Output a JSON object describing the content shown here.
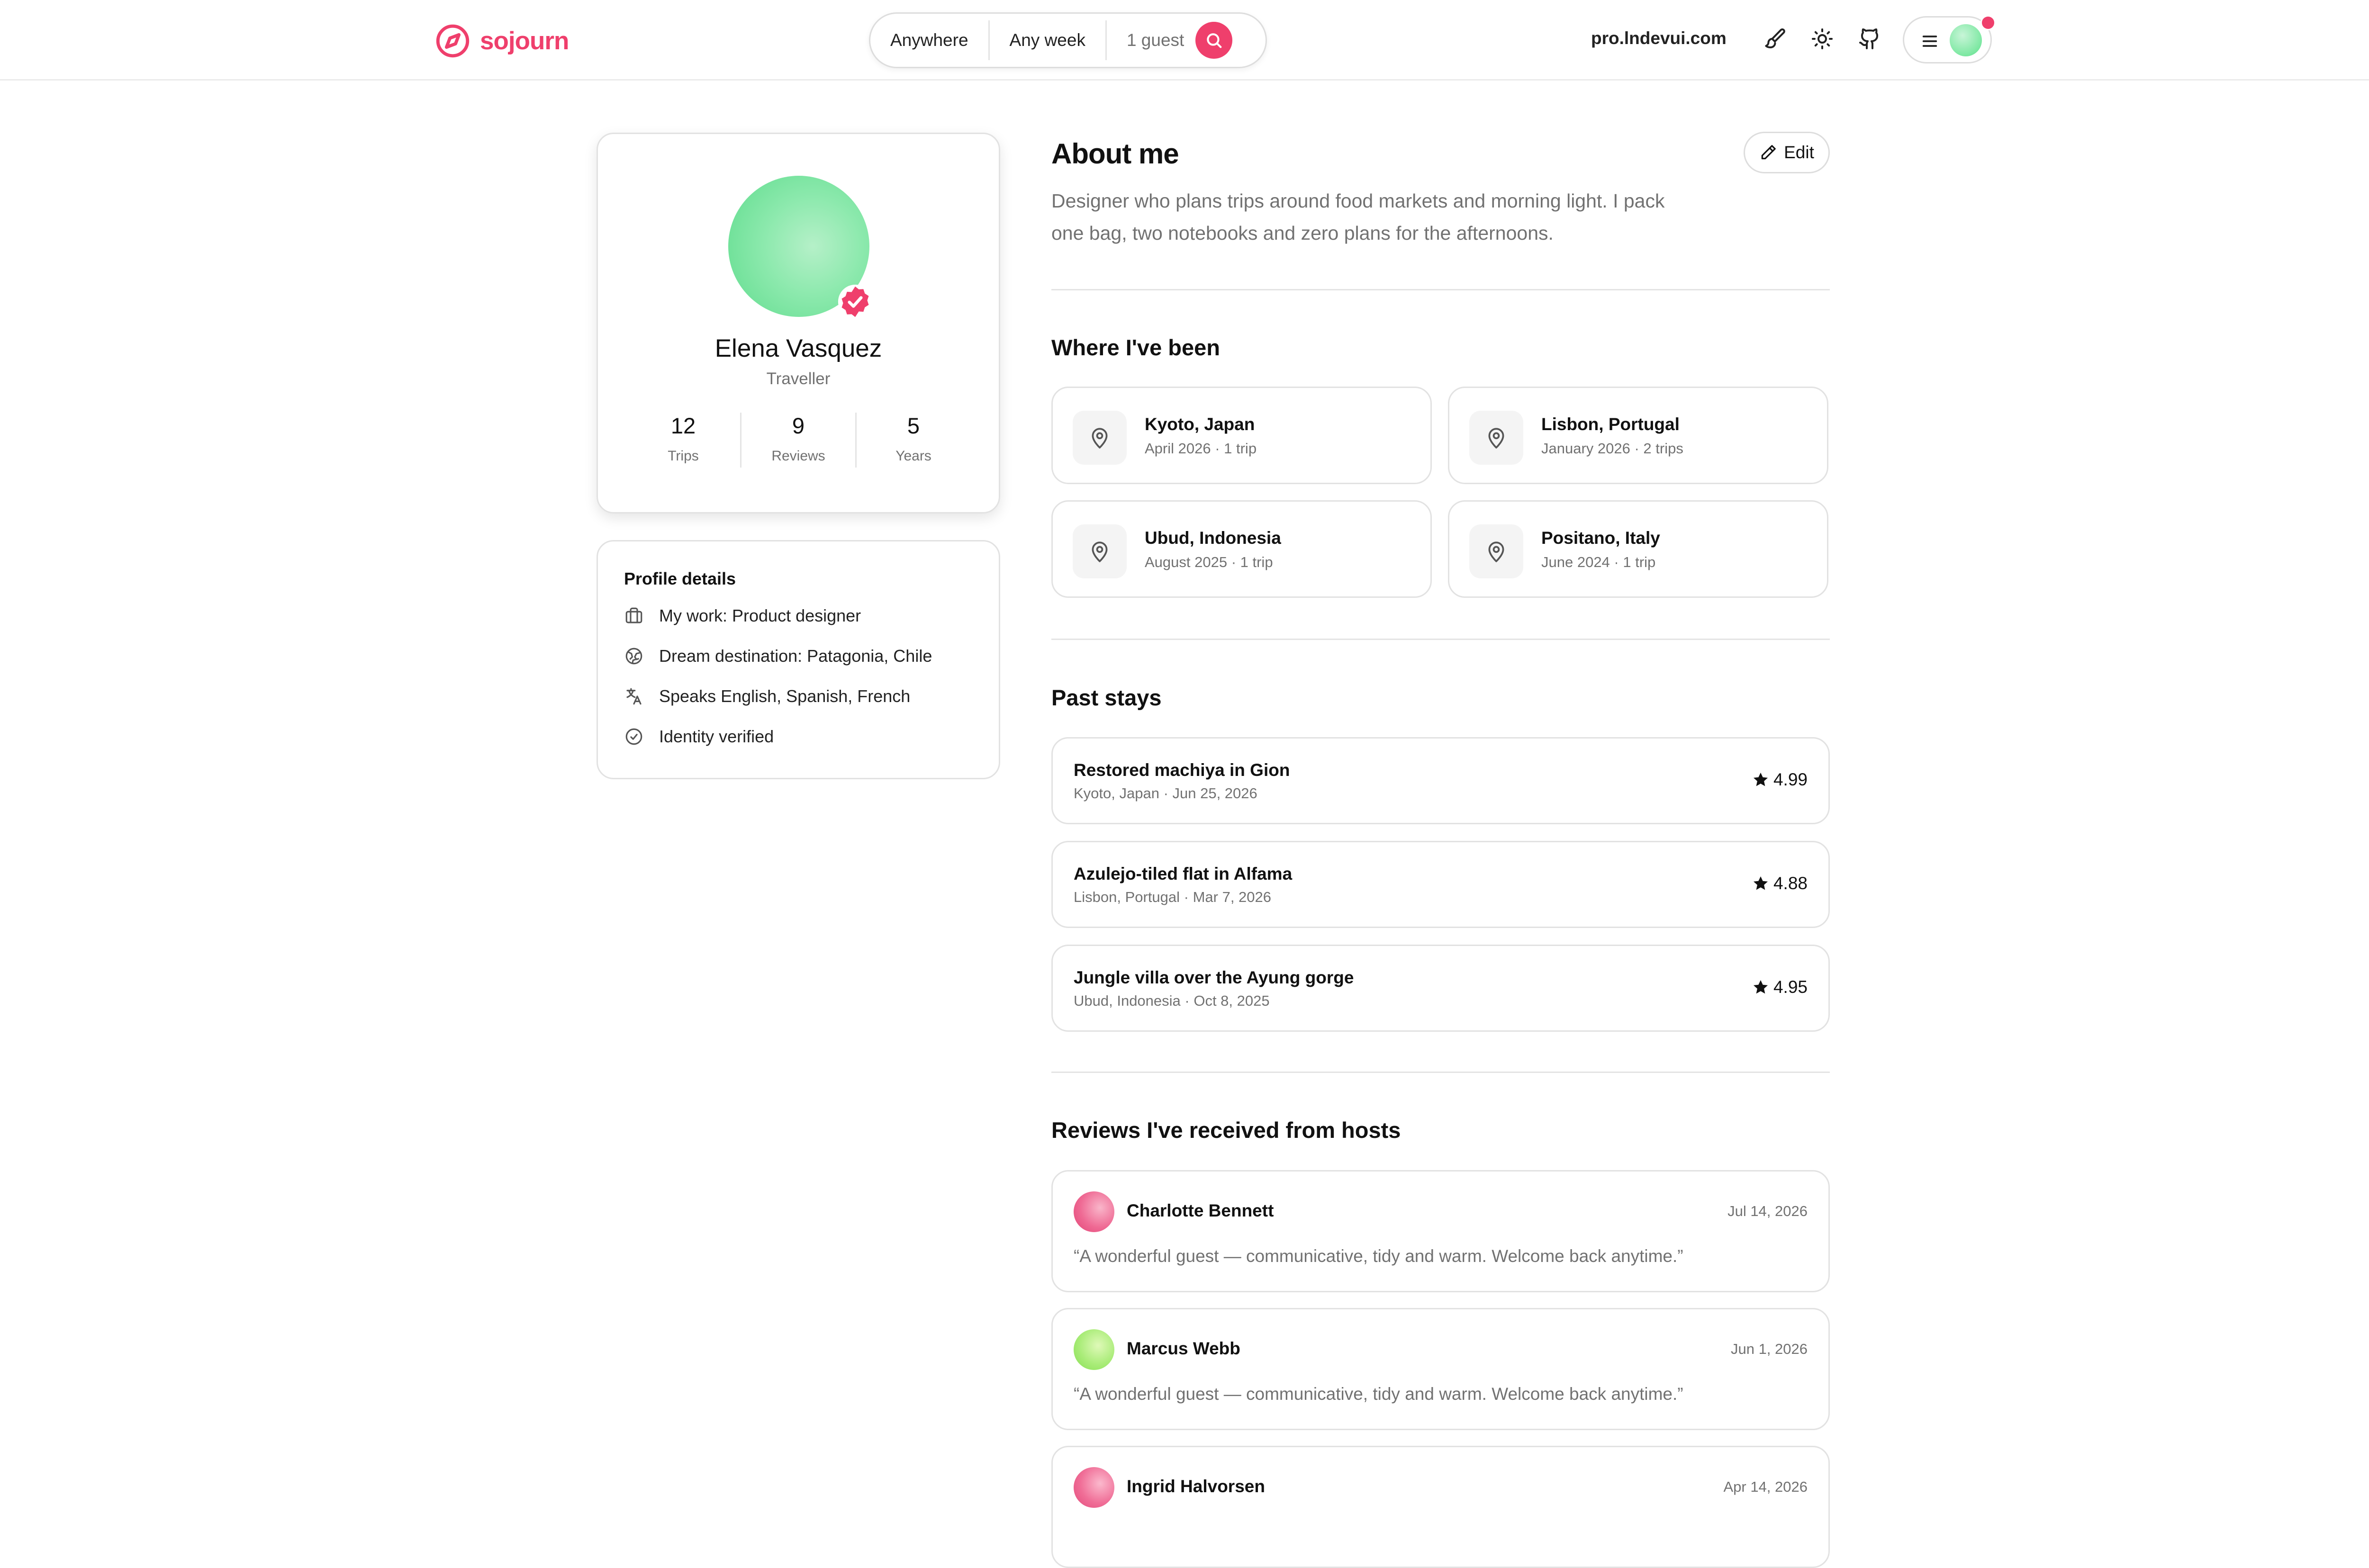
{
  "brand": {
    "name": "sojourn",
    "accent": "#ef3f6c"
  },
  "search": {
    "where": "Anywhere",
    "when": "Any week",
    "guests": "1 guest"
  },
  "header": {
    "domain": "pro.lndevui.com"
  },
  "profile": {
    "name": "Elena Vasquez",
    "role": "Traveller",
    "verified": true,
    "stats": [
      {
        "value": "12",
        "label": "Trips"
      },
      {
        "value": "9",
        "label": "Reviews"
      },
      {
        "value": "5",
        "label": "Years"
      }
    ]
  },
  "details": {
    "title": "Profile details",
    "items": [
      {
        "icon": "briefcase-icon",
        "text": "My work: Product designer"
      },
      {
        "icon": "globe-icon",
        "text": "Dream destination: Patagonia, Chile"
      },
      {
        "icon": "language-icon",
        "text": "Speaks English, Spanish, French"
      },
      {
        "icon": "check-circle-icon",
        "text": "Identity verified"
      }
    ]
  },
  "about": {
    "title": "About me",
    "edit_label": "Edit",
    "line1": "Designer who plans trips around food markets and morning light. I pack",
    "line2": "one bag, two notebooks and zero plans for the afternoons."
  },
  "places": {
    "title": "Where I've been",
    "items": [
      {
        "name": "Kyoto, Japan",
        "meta": "April 2026 · 1 trip"
      },
      {
        "name": "Lisbon, Portugal",
        "meta": "January 2026 · 2 trips"
      },
      {
        "name": "Ubud, Indonesia",
        "meta": "August 2025 · 1 trip"
      },
      {
        "name": "Positano, Italy",
        "meta": "June 2024 · 1 trip"
      }
    ]
  },
  "stays": {
    "title": "Past stays",
    "items": [
      {
        "title": "Restored machiya in Gion",
        "meta": "Kyoto, Japan · Jun 25, 2026",
        "rating": "4.99"
      },
      {
        "title": "Azulejo-tiled flat in Alfama",
        "meta": "Lisbon, Portugal · Mar 7, 2026",
        "rating": "4.88"
      },
      {
        "title": "Jungle villa over the Ayung gorge",
        "meta": "Ubud, Indonesia · Oct 8, 2025",
        "rating": "4.95"
      }
    ]
  },
  "reviews": {
    "title": "Reviews I've received from hosts",
    "items": [
      {
        "name": "Charlotte Bennett",
        "date": "Jul 14, 2026",
        "text": "“A wonderful guest — communicative, tidy and warm. Welcome back anytime.”"
      },
      {
        "name": "Marcus Webb",
        "date": "Jun 1, 2026",
        "text": "“A wonderful guest — communicative, tidy and warm. Welcome back anytime.”"
      },
      {
        "name": "Ingrid Halvorsen",
        "date": "Apr 14, 2026",
        "text": ""
      }
    ]
  }
}
